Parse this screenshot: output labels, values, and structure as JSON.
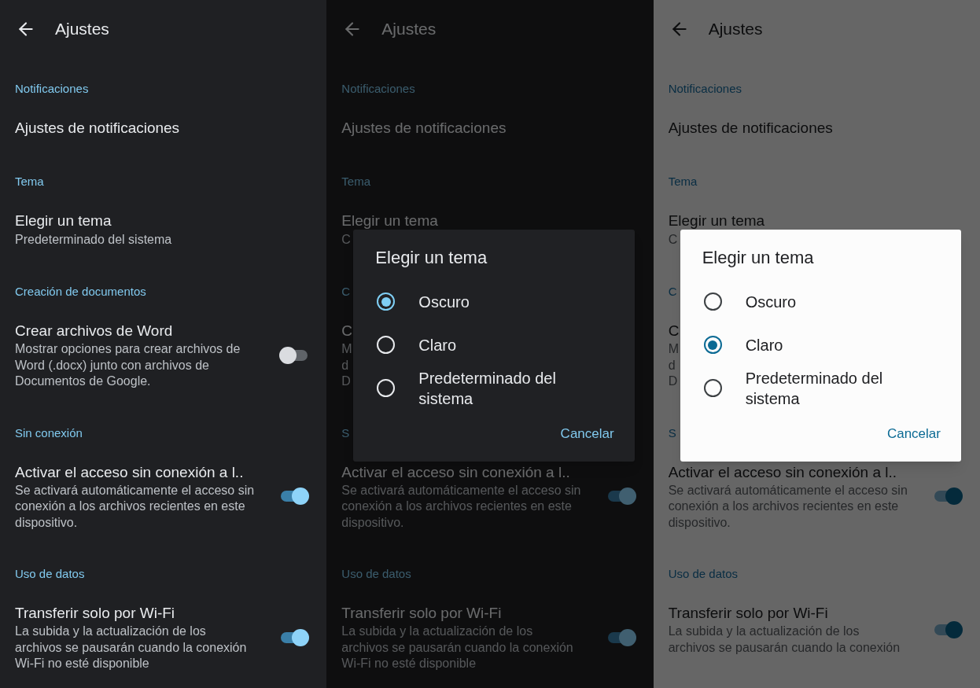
{
  "panels": [
    {
      "kind": "dark",
      "header": {
        "title": "Ajustes"
      },
      "sections": [
        {
          "heading": "Notificaciones",
          "items": [
            {
              "title": "Ajustes de notificaciones"
            }
          ]
        },
        {
          "heading": "Tema",
          "items": [
            {
              "title": "Elegir un tema",
              "subtitle": "Predeterminado del sistema"
            }
          ]
        },
        {
          "heading": "Creación de documentos",
          "items": [
            {
              "title": "Crear archivos de Word",
              "description": "Mostrar opciones para crear archivos de Word (.docx) junto con archivos de Documentos de Google.",
              "on": false
            }
          ]
        },
        {
          "heading": "Sin conexión",
          "items": [
            {
              "title": "Activar el acceso sin conexión a l..",
              "description": "Se activará automáticamente el acceso sin conexión a los archivos recientes en este dispositivo.",
              "on": true
            }
          ]
        },
        {
          "heading": "Uso de datos",
          "items": [
            {
              "title": "Transferir solo por Wi-Fi",
              "description": "La subida y la actualización de los archivos se pausarán cuando la conexión Wi-Fi no esté disponible",
              "on": true
            }
          ]
        }
      ]
    },
    {
      "kind": "dark",
      "header": {
        "title": "Ajustes"
      },
      "sections": [
        {
          "heading": "Notificaciones",
          "items": [
            {
              "title": "Ajustes de notificaciones"
            }
          ]
        },
        {
          "heading": "Tema",
          "items": [
            {
              "title": "Elegir un tema",
              "subtitle": "C"
            }
          ]
        },
        {
          "heading": "C",
          "items": [
            {
              "title": "C",
              "description": "M\nd\nD"
            }
          ]
        },
        {
          "heading": "S",
          "items": [
            {
              "title": "Activar el acceso sin conexión a l..",
              "description": "Se activará automáticamente el acceso sin conexión a los archivos recientes en este dispositivo.",
              "on": true
            }
          ]
        },
        {
          "heading": "Uso de datos",
          "items": [
            {
              "title": "Transferir solo por Wi-Fi",
              "description": "La subida y la actualización de los archivos se pausarán cuando la conexión Wi-Fi no esté disponible",
              "on": true
            }
          ]
        }
      ],
      "dialog": {
        "title": "Elegir un tema",
        "options": [
          {
            "label": "Oscuro",
            "selected": true
          },
          {
            "label": "Claro",
            "selected": false
          },
          {
            "label": "Predeterminado del sistema",
            "selected": false
          }
        ],
        "button": "Cancelar"
      }
    },
    {
      "kind": "light",
      "header": {
        "title": "Ajustes"
      },
      "sections": [
        {
          "heading": "Notificaciones",
          "items": [
            {
              "title": "Ajustes de notificaciones"
            }
          ]
        },
        {
          "heading": "Tema",
          "items": [
            {
              "title": "Elegir un tema",
              "subtitle": "C"
            }
          ]
        },
        {
          "heading": "C",
          "items": [
            {
              "title": "C",
              "description": "M\nd\nD"
            }
          ]
        },
        {
          "heading": "S",
          "items": [
            {
              "title": "Activar el acceso sin conexión a l..",
              "description": "Se activará automáticamente el acceso sin conexión a los archivos recientes en este dispositivo.",
              "on": true
            }
          ]
        },
        {
          "heading": "Uso de datos",
          "items": [
            {
              "title": "Transferir solo por Wi-Fi",
              "description": "La subida y la actualización de los archivos se pausarán cuando la conexión",
              "on": true
            }
          ]
        }
      ],
      "dialog": {
        "title": "Elegir un tema",
        "options": [
          {
            "label": "Oscuro",
            "selected": false
          },
          {
            "label": "Claro",
            "selected": true
          },
          {
            "label": "Predeterminado del sistema",
            "selected": false
          }
        ],
        "button": "Cancelar"
      }
    }
  ]
}
